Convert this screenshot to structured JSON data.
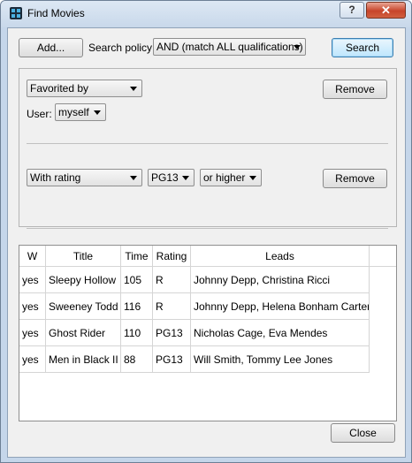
{
  "window": {
    "title": "Find Movies",
    "help_label": "?",
    "close_label": "✕"
  },
  "toolbar": {
    "add_label": "Add...",
    "policy_label": "Search policy:",
    "policy_value": "AND (match ALL qualifications)",
    "search_label": "Search"
  },
  "criteria": [
    {
      "field": "Favorited by",
      "sub_label": "User:",
      "sub_value": "myself",
      "remove_label": "Remove"
    },
    {
      "field": "With rating",
      "rating_value": "PG13",
      "comparator": "or higher",
      "remove_label": "Remove"
    }
  ],
  "table": {
    "columns": [
      "W",
      "Title",
      "Time",
      "Rating",
      "Leads"
    ],
    "rows": [
      [
        "yes",
        "Sleepy Hollow",
        "105",
        "R",
        "Johnny Depp, Christina Ricci"
      ],
      [
        "yes",
        "Sweeney Todd",
        "116",
        "R",
        "Johnny Depp, Helena Bonham Carter"
      ],
      [
        "yes",
        "Ghost Rider",
        "110",
        "PG13",
        "Nicholas Cage, Eva Mendes"
      ],
      [
        "yes",
        "Men in Black II",
        "88",
        "PG13",
        "Will Smith, Tommy Lee Jones"
      ]
    ]
  },
  "footer": {
    "close_label": "Close"
  }
}
